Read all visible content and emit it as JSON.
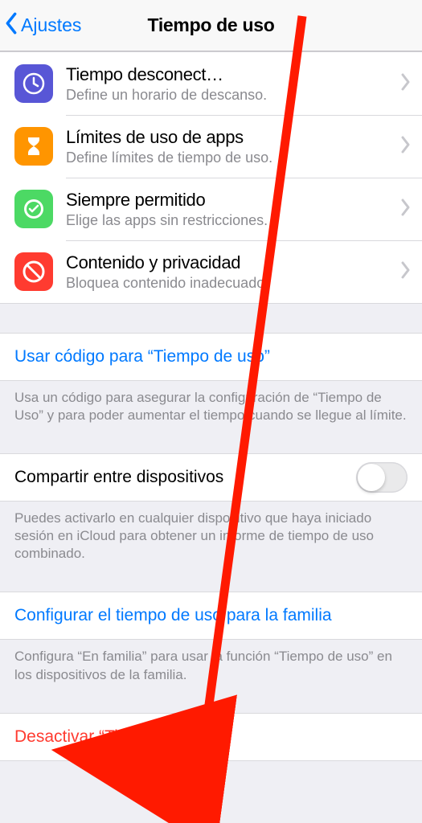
{
  "nav": {
    "back": "Ajustes",
    "title": "Tiempo de uso"
  },
  "options": {
    "downtime": {
      "title": "Tiempo desconect…",
      "sub": "Define un horario de descanso."
    },
    "limits": {
      "title": "Límites de uso de apps",
      "sub": "Define límites de tiempo de uso."
    },
    "allowed": {
      "title": "Siempre permitido",
      "sub": "Elige las apps sin restricciones."
    },
    "content": {
      "title": "Contenido y privacidad",
      "sub": "Bloquea contenido inadecuado."
    }
  },
  "passcode": {
    "link": "Usar código para “Tiempo de uso”",
    "note": "Usa un código para asegurar la configuración de “Tiempo de Uso” y para poder aumentar el tiempo cuando se llegue al límite."
  },
  "share": {
    "label": "Compartir entre dispositivos",
    "note": "Puedes activarlo en cualquier dispositivo que haya iniciado sesión en iCloud para obtener un informe de tiempo de uso combinado."
  },
  "family": {
    "link": "Configurar el tiempo de uso para la familia",
    "note": "Configura “En familia” para usar la función “Tiempo de uso” en los dispositivos de la familia."
  },
  "disable": {
    "label": "Desactivar “Tiempo de uso”"
  }
}
